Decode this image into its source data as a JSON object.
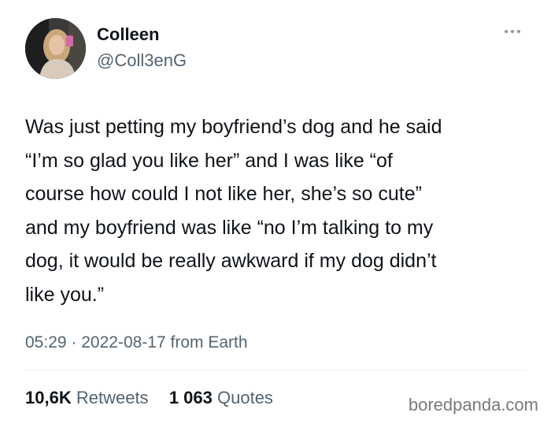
{
  "user": {
    "display_name": "Colleen",
    "handle": "@Coll3enG"
  },
  "tweet": {
    "text": "Was just petting my boyfriend’s dog and he said\n“I’m so glad you like her” and I was like “of\ncourse how could I not like her, she’s so cute”\nand my boyfriend was like “no I’m talking to my\ndog, it would be really awkward if my dog didn’t\nlike you.”",
    "time": "05:29",
    "separator": "·",
    "date": "2022-08-17",
    "source": "from Earth"
  },
  "stats": {
    "retweets_count": "10,6K",
    "retweets_label": "Retweets",
    "quotes_count": "1 063",
    "quotes_label": "Quotes"
  },
  "watermark": "boredpanda.com",
  "icons": {
    "more": "more-options-icon",
    "avatar": "avatar"
  },
  "colors": {
    "text_primary": "#0f1419",
    "text_secondary": "#536471",
    "divider": "#eff3f4",
    "watermark": "#7a7a7a"
  }
}
